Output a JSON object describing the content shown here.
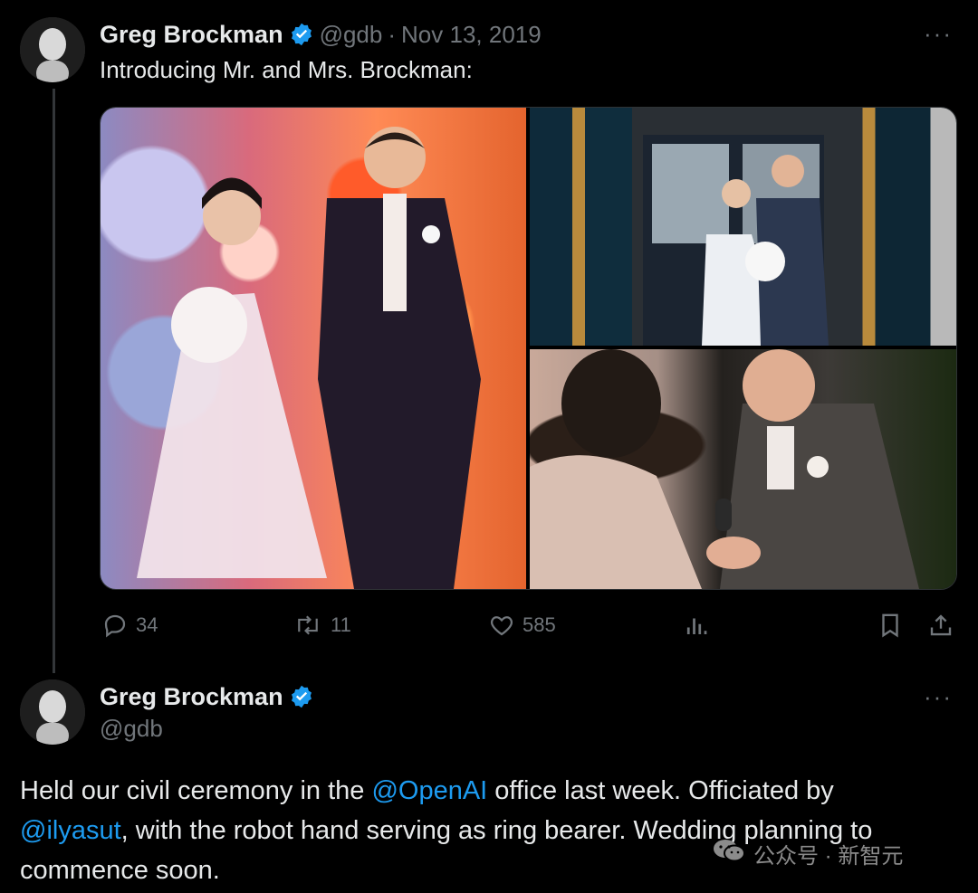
{
  "tweet1": {
    "author_name": "Greg Brockman",
    "handle": "@gdb",
    "separator": "·",
    "date": "Nov 13, 2019",
    "more": "···",
    "text": "Introducing Mr. and Mrs. Brockman:",
    "actions": {
      "replies": "34",
      "retweets": "11",
      "likes": "585"
    }
  },
  "tweet2": {
    "author_name": "Greg Brockman",
    "handle": "@gdb",
    "more": "···",
    "text_part1": "Held our civil ceremony in the ",
    "mention1": "@OpenAI",
    "text_part2": " office last week. Officiated by",
    "mention2": "@ilyasut",
    "text_part3": ", with the robot hand serving as ring bearer. Wedding planning to",
    "text_part4": "commence soon."
  },
  "watermark": {
    "text": "公众号 · 新智元"
  },
  "icons": {
    "verified": "verified-badge-icon",
    "reply": "reply-icon",
    "retweet": "retweet-icon",
    "like": "heart-icon",
    "views": "views-icon",
    "bookmark": "bookmark-icon",
    "share": "share-icon",
    "wechat": "wechat-icon"
  },
  "colors": {
    "background": "#000000",
    "text": "#e7e9ea",
    "muted": "#71767b",
    "accent": "#1d9bf0"
  }
}
